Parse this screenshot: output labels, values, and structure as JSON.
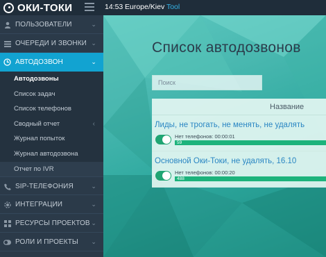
{
  "header": {
    "logo_text": "ОКИ-ТОКИ",
    "time": "14:53",
    "timezone": "Europe/Kiev",
    "tool_link": "Tool"
  },
  "sidebar": {
    "items": [
      {
        "label": "ПОЛЬЗОВАТЕЛИ",
        "icon": "user-icon"
      },
      {
        "label": "ОЧЕРЕДИ И ЗВОНКИ",
        "icon": "queue-icon"
      },
      {
        "label": "АВТОДОЗВОН",
        "icon": "autodial-icon",
        "active": true
      }
    ],
    "subitems": [
      {
        "label": "Автодозвоны",
        "current": true
      },
      {
        "label": "Список задач"
      },
      {
        "label": "Список телефонов"
      },
      {
        "label": "Сводный отчет",
        "has_chevron": true
      },
      {
        "label": "Журнал попыток"
      },
      {
        "label": "Журнал автодозвона"
      },
      {
        "label": "Отчет по IVR",
        "highlight": true
      }
    ],
    "bottom_items": [
      {
        "label": "SIP-ТЕЛЕФОНИЯ",
        "icon": "phone-icon"
      },
      {
        "label": "ИНТЕГРАЦИИ",
        "icon": "integration-icon"
      },
      {
        "label": "РЕСУРСЫ ПРОЕКТОВ",
        "icon": "grid-icon"
      },
      {
        "label": "РОЛИ И ПРОЕКТЫ",
        "icon": "toggle-icon"
      }
    ]
  },
  "main": {
    "title": "Список автодозвонов",
    "search_placeholder": "Поиск",
    "table": {
      "column_header": "Название",
      "rows": [
        {
          "name": "Лиды, не трогать, не менять, не удалять",
          "meta": "Нет телефонов: 00:00:01",
          "count": "59",
          "enabled": true
        },
        {
          "name": "Основной Оки-Токи, не удалять, 16.10",
          "meta": "Нет телефонов: 00:00:20",
          "count": "488",
          "enabled": true
        }
      ]
    }
  },
  "colors": {
    "accent": "#12a3d1",
    "toggle": "#1fa573",
    "progress": "#1db37c",
    "link": "#2a86c3"
  }
}
